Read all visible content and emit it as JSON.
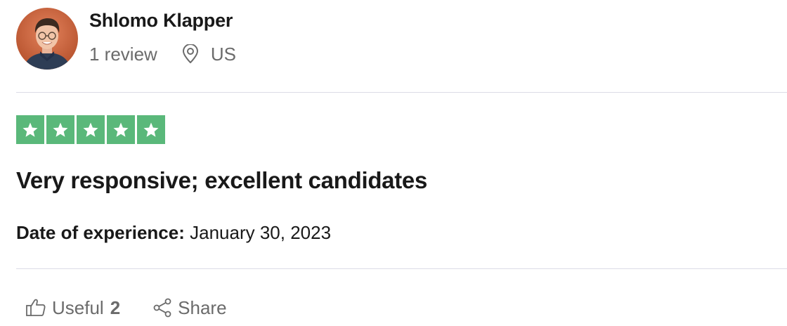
{
  "reviewer": {
    "name": "Shlomo Klapper",
    "review_count": "1 review",
    "location": "US",
    "avatar_icon": "person-avatar"
  },
  "rating": {
    "stars": 5,
    "max_stars": 5,
    "color": "#5ab87a",
    "icon": "star-icon"
  },
  "review": {
    "title": "Very responsive; excellent candidates",
    "experience_label": "Date of experience:",
    "experience_date": "January 30, 2023"
  },
  "actions": {
    "useful_label": "Useful",
    "useful_count": "2",
    "useful_icon": "thumbs-up-icon",
    "share_label": "Share",
    "share_icon": "share-icon"
  },
  "colors": {
    "text_primary": "#191919",
    "text_secondary": "#6b6b6b",
    "divider": "#dcdce6"
  }
}
